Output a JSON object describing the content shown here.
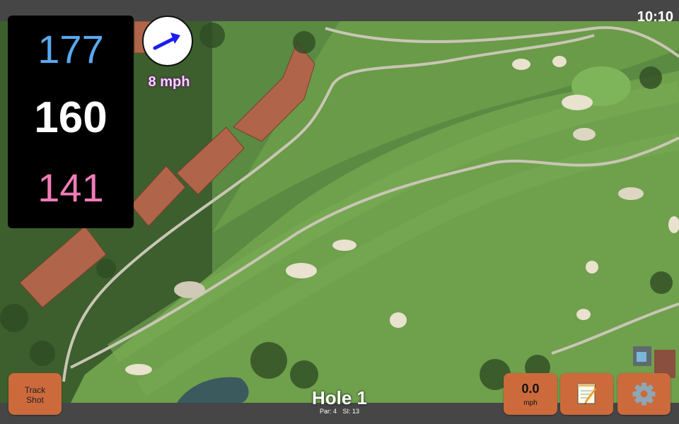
{
  "status": {
    "time": "10:10"
  },
  "distances": {
    "back": "177",
    "middle": "160",
    "front": "141"
  },
  "wind": {
    "speed": "8 mph",
    "direction_icon": "wind-arrow-icon",
    "arrow_color": "#1d1df0"
  },
  "hole": {
    "title": "Hole 1",
    "par": "Par: 4",
    "si": "SI: 13"
  },
  "buttons": {
    "track_line1": "Track",
    "track_line2": "Shot",
    "speed_value": "0.0",
    "speed_unit": "mph",
    "notes_icon": "notepad-icon",
    "settings_icon": "gear-icon"
  },
  "colors": {
    "button": "#cc6a3c",
    "back_distance": "#5aa8ee",
    "front_distance": "#f07cb8",
    "panel": "#000000"
  }
}
